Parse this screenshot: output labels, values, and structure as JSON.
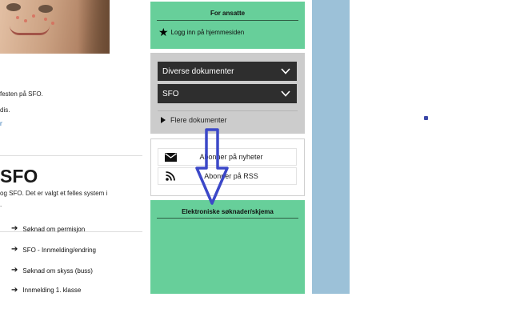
{
  "left": {
    "line1": "festen på SFO.",
    "line2": "dis.",
    "link": "n",
    "heading": "SFO",
    "line3": "og SFO. Det er valgt et felles system i",
    "line4": "."
  },
  "ansatte": {
    "title": "For ansatte",
    "login": "Logg inn på hjemmesiden",
    "icon": "star-icon"
  },
  "documents": {
    "dropdowns": [
      "Diverse dokumenter",
      "SFO"
    ],
    "more": "Flere dokumenter"
  },
  "subscribe": {
    "news": "Abonner på nyheter",
    "rss": "Abonner på RSS",
    "news_icon": "envelope-icon",
    "rss_icon": "rss-icon"
  },
  "forms": {
    "title": "Elektroniske søknader/skjema",
    "items": [
      "Søknad om permisjon",
      "SFO - Innmelding/endring",
      "Søknad om skyss (buss)",
      "Innmelding 1. klasse"
    ]
  },
  "colors": {
    "green": "#67cf9a",
    "dark": "#2e2e2e",
    "grey_panel": "#cccccc",
    "blue_column": "#9cc1d8",
    "annotation": "#3c48c8"
  }
}
